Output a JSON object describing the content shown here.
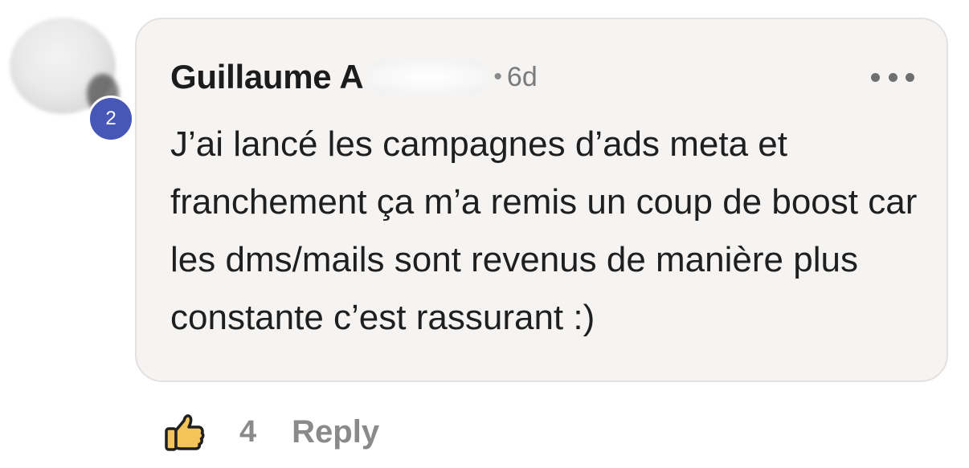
{
  "comment": {
    "author_name": "Guillaume",
    "author_initial": "A",
    "separator": "•",
    "time_ago": "6d",
    "text": "J’ai lancé les campagnes d’ads meta et franchement ça m’a remis un coup de boost car les dms/mails sont revenus de manière plus constante c’est rassurant :)",
    "level_badge": "2",
    "like_count": "4",
    "reply_label": "Reply",
    "more_icon": "more-horizontal-icon",
    "like_icon": "thumbs-up-icon"
  },
  "colors": {
    "badge": "#4657b8",
    "bubble_bg": "#f5f4f3",
    "like_fill": "#f2c45a",
    "muted_text": "#8a8a8a"
  }
}
